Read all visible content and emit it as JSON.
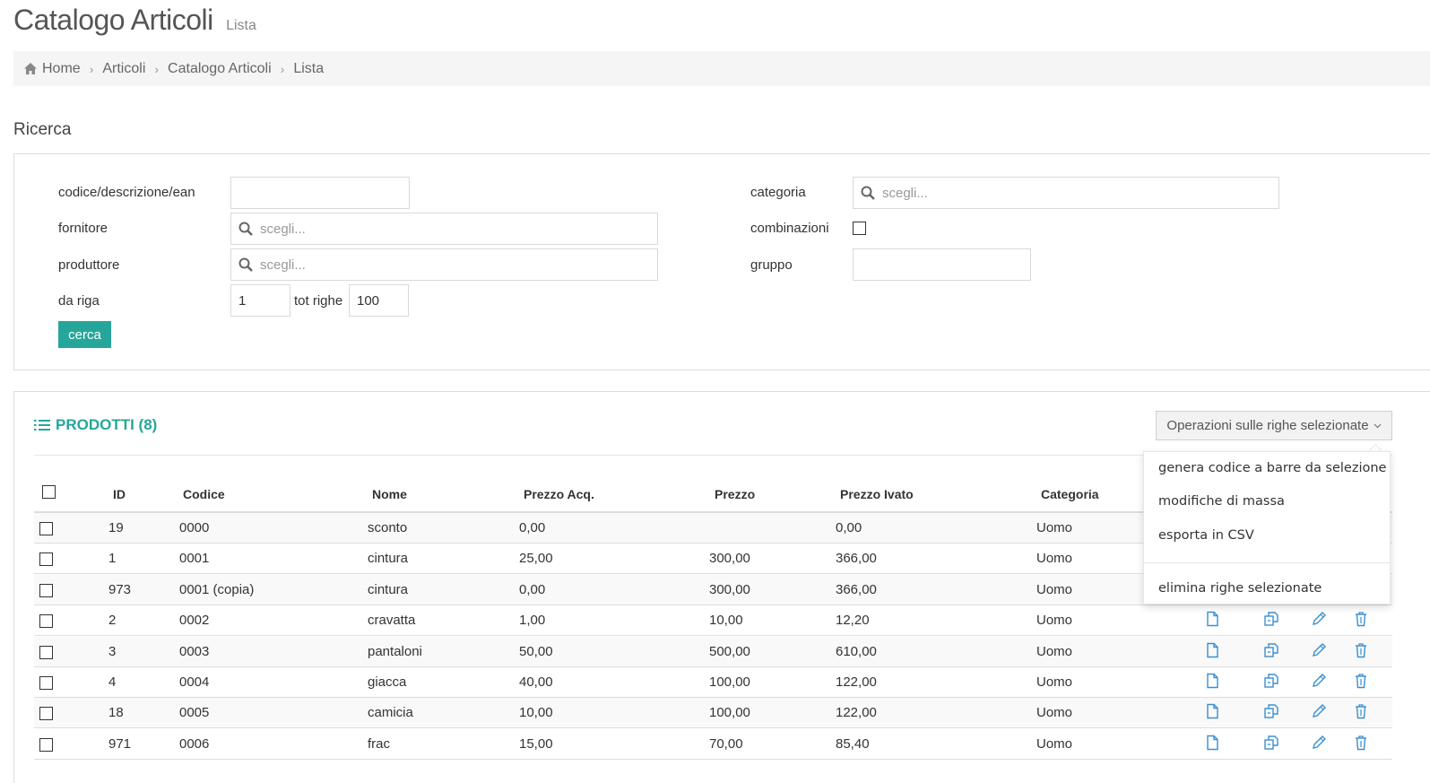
{
  "page": {
    "title": "Catalogo Articoli",
    "subtitle": "Lista"
  },
  "breadcrumb": [
    "Home",
    "Articoli",
    "Catalogo Articoli",
    "Lista"
  ],
  "search": {
    "title": "Ricerca",
    "labels": {
      "codice": "codice/descrizione/ean",
      "fornitore": "fornitore",
      "produttore": "produttore",
      "da_riga": "da riga",
      "tot_righe": "tot righe",
      "categoria": "categoria",
      "combinazioni": "combinazioni",
      "gruppo": "gruppo"
    },
    "values": {
      "codice": "",
      "da_riga": "1",
      "tot_righe": "100",
      "gruppo": "",
      "combinazioni": false
    },
    "placeholder": "scegli...",
    "button": "cerca"
  },
  "list": {
    "title": "PRODOTTI (8)",
    "operations_button": "Operazioni sulle righe selezionate",
    "dropdown": [
      "genera codice a barre da selezione",
      "modifiche di massa",
      "esporta in CSV",
      "elimina righe selezionate"
    ],
    "columns": [
      "ID",
      "Codice",
      "Nome",
      "Prezzo Acq.",
      "Prezzo",
      "Prezzo Ivato",
      "Categoria"
    ],
    "rows": [
      [
        "19",
        "0000",
        "sconto",
        "0,00",
        "",
        "0,00",
        "Uomo"
      ],
      [
        "1",
        "0001",
        "cintura",
        "25,00",
        "300,00",
        "366,00",
        "Uomo"
      ],
      [
        "973",
        "0001 (copia)",
        "cintura",
        "0,00",
        "300,00",
        "366,00",
        "Uomo"
      ],
      [
        "2",
        "0002",
        "cravatta",
        "1,00",
        "10,00",
        "12,20",
        "Uomo"
      ],
      [
        "3",
        "0003",
        "pantaloni",
        "50,00",
        "500,00",
        "610,00",
        "Uomo"
      ],
      [
        "4",
        "0004",
        "giacca",
        "40,00",
        "100,00",
        "122,00",
        "Uomo"
      ],
      [
        "18",
        "0005",
        "camicia",
        "10,00",
        "100,00",
        "122,00",
        "Uomo"
      ],
      [
        "971",
        "0006",
        "frac",
        "15,00",
        "70,00",
        "85,40",
        "Uomo"
      ]
    ],
    "row_actions": [
      "file-icon",
      "copy-icon",
      "pencil-icon",
      "trash-icon"
    ]
  },
  "colors": {
    "accent": "#26a69a",
    "action_icon": "#3a8fd0"
  }
}
